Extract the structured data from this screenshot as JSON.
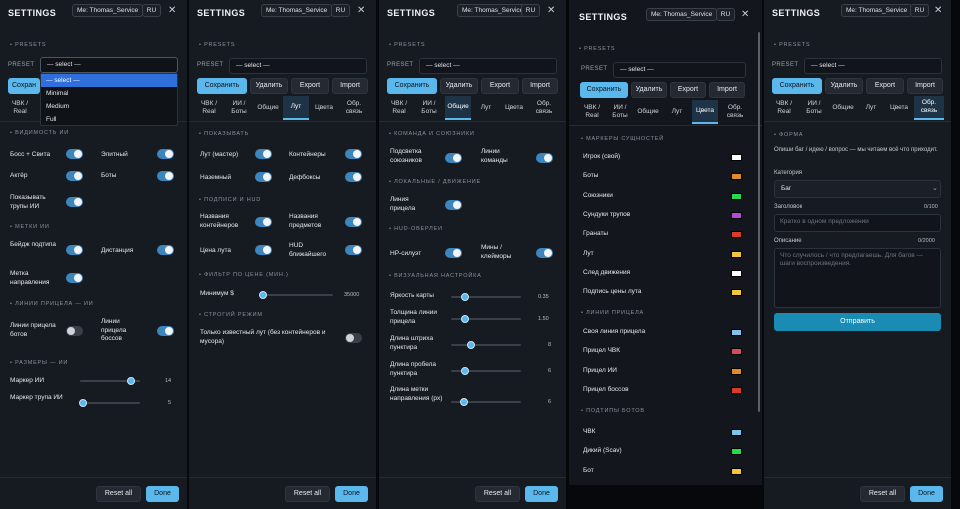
{
  "colors": {
    "accent": "#5bb8ec",
    "toggle_on": "#3c85bd",
    "send_button": "#1a8bb3"
  },
  "common": {
    "title": "SETTINGS",
    "me": "Me: Thomas_Service",
    "lang": "RU",
    "close": "✕",
    "presets": "PRESETS",
    "preset_label": "PRESET",
    "select": "— select —",
    "save": "Сохранить",
    "delete": "Удалить",
    "export": "Export",
    "import": "Import",
    "reset": "Reset all",
    "done": "Done",
    "tabs": [
      "ЧВК / Real",
      "ИИ / Боты",
      "Общие",
      "Лут",
      "Цвета",
      "Обр. связь"
    ],
    "tabs_short": {
      "save_cut": "Сохран"
    }
  },
  "p1": {
    "dropdown": [
      "— select —",
      "Minimal",
      "Medium",
      "Full"
    ],
    "sec_visibility": "ВИДИМОСТЬ ИИ",
    "boss": "Босс + Свита",
    "elite": "Элитный",
    "actor": "Актёр",
    "bots": "Боты",
    "show_bodies": "Показывать трупы ИИ",
    "sec_marks": "МЕТКИ ИИ",
    "badge": "Бейдж подтипа",
    "distance": "Дистанция",
    "dir_mark": "Метка направления",
    "sec_lines": "ЛИНИИ ПРИЦЕЛА — ИИ",
    "bot_lines": "Линии прицела ботов",
    "boss_lines": "Линии прицела боссов",
    "sec_sizes": "РАЗМЕРЫ — ИИ",
    "ai_marker": "Маркер ИИ",
    "ai_marker_val": "14",
    "body_marker": "Маркер трупа ИИ",
    "body_marker_val": "5",
    "levels": {
      "ai_marker": 0.85,
      "body_marker": 0.05
    }
  },
  "p2": {
    "sec_show": "ПОКАЗЫВАТЬ",
    "loot_master": "Лут (мастер)",
    "containers": "Контейнеры",
    "ground": "Наземный",
    "duffle": "Дефбоксы",
    "sec_labels": "ПОДПИСИ И HUD",
    "cont_names": "Названия контейнеров",
    "item_names": "Названия предметов",
    "loot_price": "Цена лута",
    "hud_nearest": "HUD ближайшего",
    "sec_filter": "ФИЛЬТР ПО ЦЕНЕ (МИН.)",
    "min_label": "Минимум $",
    "min_val": "35000",
    "sec_strict": "СТРОГИЙ РЕЖИМ",
    "strict_label": "Только известный лут (без контейнеров и мусора)",
    "levels": {
      "min": 0.0
    }
  },
  "p3": {
    "sec_team": "КОМАНДА И СОЮЗНИКИ",
    "ally_hl": "Подсветка союзников",
    "team_lines": "Линии команды",
    "sec_local": "ЛОКАЛЬНЫЕ / ДВИЖЕНИЕ",
    "aim_line": "Линия прицела",
    "sec_hud": "HUD-ОВЕРЛЕИ",
    "hp": "HP-силуэт",
    "mines": "Мины / клейморы",
    "sec_visual": "ВИЗУАЛЬНАЯ НАСТРОЙКА",
    "map_bright": "Яркость карты",
    "map_bright_val": "0.35",
    "aim_thick": "Толщина линии прицела",
    "aim_thick_val": "1.50",
    "dash_len": "Длина штриха пунктира",
    "dash_len_val": "8",
    "gap_len": "Длина пробела пунктира",
    "gap_len_val": "6",
    "dir_len": "Длина метки направления (px)",
    "dir_len_val": "6",
    "levels": {
      "map_bright": 0.2,
      "aim_thick": 0.2,
      "dash_len": 0.28,
      "gap_len": 0.2,
      "dir_len": 0.18
    }
  },
  "p4": {
    "sec_markers": "МАРКЕРЫ СУЩНОСТЕЙ",
    "entities": [
      {
        "label": "Игрок (свой)",
        "color": "#ffffff"
      },
      {
        "label": "Боты",
        "color": "#e08a2a"
      },
      {
        "label": "Союзники",
        "color": "#2ad94a"
      },
      {
        "label": "Сундуки трупов",
        "color": "#b04ad9"
      },
      {
        "label": "Гранаты",
        "color": "#d93a2a"
      },
      {
        "label": "Лут",
        "color": "#f2c53a"
      },
      {
        "label": "След движения",
        "color": "#ffffff"
      },
      {
        "label": "Подпись цены лута",
        "color": "#f2c53a"
      }
    ],
    "sec_lines": "ЛИНИИ ПРИЦЕЛА",
    "lines": [
      {
        "label": "Своя линия прицела",
        "color": "#7ec3ea"
      },
      {
        "label": "Прицел ЧВК",
        "color": "#d94a5a"
      },
      {
        "label": "Прицел ИИ",
        "color": "#e08a2a"
      },
      {
        "label": "Прицел боссов",
        "color": "#d93a2a"
      }
    ],
    "sec_subtypes": "ПОДТИПЫ БОТОВ",
    "subtypes": [
      {
        "label": "ЧВК",
        "color": "#7ec3ea"
      },
      {
        "label": "Дикий (Scav)",
        "color": "#2ad94a"
      },
      {
        "label": "Бот",
        "color": "#f2c53a"
      }
    ]
  },
  "p5": {
    "sec_form": "ФОРМА",
    "intro": "Опиши баг / идею / вопрос — мы читаем всё что приходит.",
    "category_label": "Категория",
    "category_val": "Баг",
    "subject_label": "Заголовок",
    "subject_count": "0/100",
    "subject_ph": "Кратко в одном предложении",
    "desc_label": "Описание",
    "desc_count": "0/2000",
    "desc_ph": "Что случилось / что предлагаешь. Для багов — шаги воспроизведения.",
    "send": "Отправить"
  }
}
